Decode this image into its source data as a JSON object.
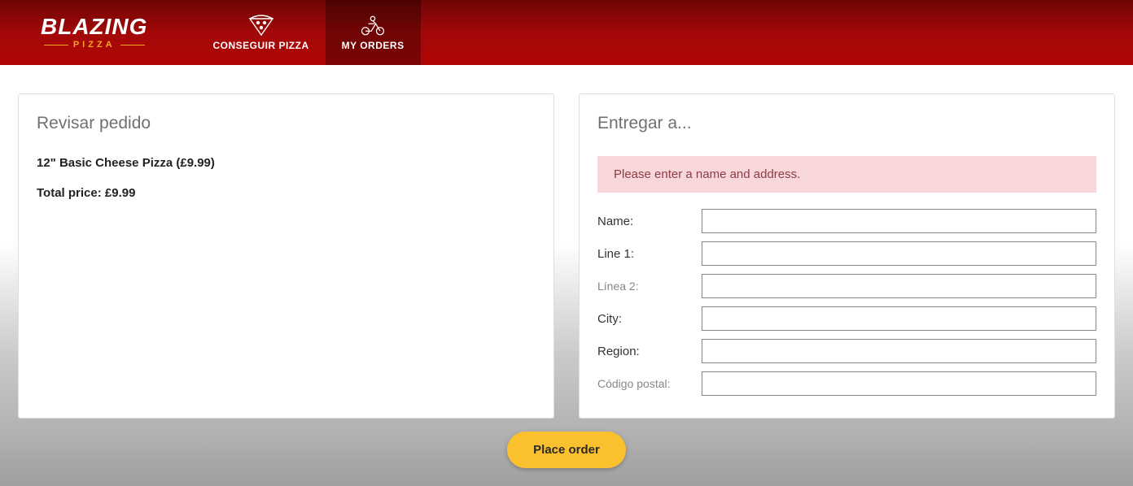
{
  "logo": {
    "top": "BLAZING",
    "bottom": "PIZZA"
  },
  "nav": {
    "get_pizza": "CONSEGUIR PIZZA",
    "my_orders": "MY ORDERS"
  },
  "review": {
    "title": "Revisar pedido",
    "item": "12\" Basic Cheese Pizza (£9.99)",
    "total_label": "Total price:",
    "total_value": "£9.99"
  },
  "deliver": {
    "title": "Entregar a...",
    "alert": "Please enter a name and address.",
    "labels": {
      "name": "Name:",
      "line1": "Line 1:",
      "line2": "Línea 2:",
      "city": "City:",
      "region": "Region:",
      "postal": "Código postal:"
    },
    "values": {
      "name": "",
      "line1": "",
      "line2": "",
      "city": "",
      "region": "",
      "postal": ""
    }
  },
  "place_order": "Place order"
}
